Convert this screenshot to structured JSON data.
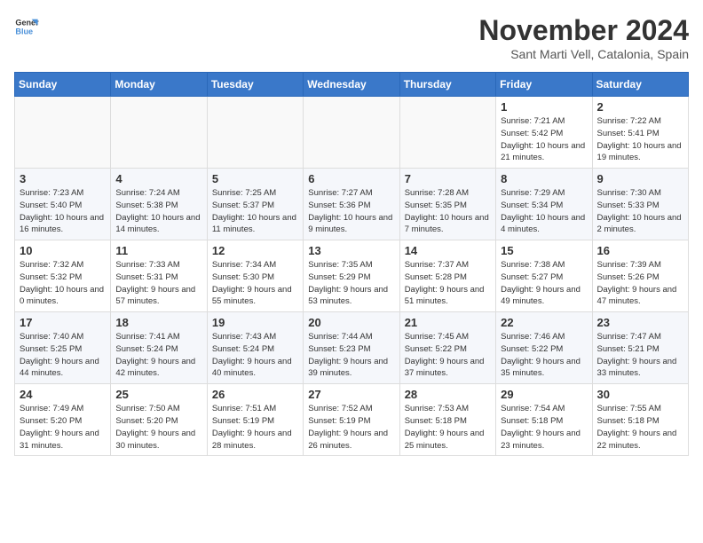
{
  "logo": {
    "line1": "General",
    "line2": "Blue"
  },
  "title": "November 2024",
  "location": "Sant Marti Vell, Catalonia, Spain",
  "headers": [
    "Sunday",
    "Monday",
    "Tuesday",
    "Wednesday",
    "Thursday",
    "Friday",
    "Saturday"
  ],
  "weeks": [
    [
      {
        "day": "",
        "info": ""
      },
      {
        "day": "",
        "info": ""
      },
      {
        "day": "",
        "info": ""
      },
      {
        "day": "",
        "info": ""
      },
      {
        "day": "",
        "info": ""
      },
      {
        "day": "1",
        "info": "Sunrise: 7:21 AM\nSunset: 5:42 PM\nDaylight: 10 hours and 21 minutes."
      },
      {
        "day": "2",
        "info": "Sunrise: 7:22 AM\nSunset: 5:41 PM\nDaylight: 10 hours and 19 minutes."
      }
    ],
    [
      {
        "day": "3",
        "info": "Sunrise: 7:23 AM\nSunset: 5:40 PM\nDaylight: 10 hours and 16 minutes."
      },
      {
        "day": "4",
        "info": "Sunrise: 7:24 AM\nSunset: 5:38 PM\nDaylight: 10 hours and 14 minutes."
      },
      {
        "day": "5",
        "info": "Sunrise: 7:25 AM\nSunset: 5:37 PM\nDaylight: 10 hours and 11 minutes."
      },
      {
        "day": "6",
        "info": "Sunrise: 7:27 AM\nSunset: 5:36 PM\nDaylight: 10 hours and 9 minutes."
      },
      {
        "day": "7",
        "info": "Sunrise: 7:28 AM\nSunset: 5:35 PM\nDaylight: 10 hours and 7 minutes."
      },
      {
        "day": "8",
        "info": "Sunrise: 7:29 AM\nSunset: 5:34 PM\nDaylight: 10 hours and 4 minutes."
      },
      {
        "day": "9",
        "info": "Sunrise: 7:30 AM\nSunset: 5:33 PM\nDaylight: 10 hours and 2 minutes."
      }
    ],
    [
      {
        "day": "10",
        "info": "Sunrise: 7:32 AM\nSunset: 5:32 PM\nDaylight: 10 hours and 0 minutes."
      },
      {
        "day": "11",
        "info": "Sunrise: 7:33 AM\nSunset: 5:31 PM\nDaylight: 9 hours and 57 minutes."
      },
      {
        "day": "12",
        "info": "Sunrise: 7:34 AM\nSunset: 5:30 PM\nDaylight: 9 hours and 55 minutes."
      },
      {
        "day": "13",
        "info": "Sunrise: 7:35 AM\nSunset: 5:29 PM\nDaylight: 9 hours and 53 minutes."
      },
      {
        "day": "14",
        "info": "Sunrise: 7:37 AM\nSunset: 5:28 PM\nDaylight: 9 hours and 51 minutes."
      },
      {
        "day": "15",
        "info": "Sunrise: 7:38 AM\nSunset: 5:27 PM\nDaylight: 9 hours and 49 minutes."
      },
      {
        "day": "16",
        "info": "Sunrise: 7:39 AM\nSunset: 5:26 PM\nDaylight: 9 hours and 47 minutes."
      }
    ],
    [
      {
        "day": "17",
        "info": "Sunrise: 7:40 AM\nSunset: 5:25 PM\nDaylight: 9 hours and 44 minutes."
      },
      {
        "day": "18",
        "info": "Sunrise: 7:41 AM\nSunset: 5:24 PM\nDaylight: 9 hours and 42 minutes."
      },
      {
        "day": "19",
        "info": "Sunrise: 7:43 AM\nSunset: 5:24 PM\nDaylight: 9 hours and 40 minutes."
      },
      {
        "day": "20",
        "info": "Sunrise: 7:44 AM\nSunset: 5:23 PM\nDaylight: 9 hours and 39 minutes."
      },
      {
        "day": "21",
        "info": "Sunrise: 7:45 AM\nSunset: 5:22 PM\nDaylight: 9 hours and 37 minutes."
      },
      {
        "day": "22",
        "info": "Sunrise: 7:46 AM\nSunset: 5:22 PM\nDaylight: 9 hours and 35 minutes."
      },
      {
        "day": "23",
        "info": "Sunrise: 7:47 AM\nSunset: 5:21 PM\nDaylight: 9 hours and 33 minutes."
      }
    ],
    [
      {
        "day": "24",
        "info": "Sunrise: 7:49 AM\nSunset: 5:20 PM\nDaylight: 9 hours and 31 minutes."
      },
      {
        "day": "25",
        "info": "Sunrise: 7:50 AM\nSunset: 5:20 PM\nDaylight: 9 hours and 30 minutes."
      },
      {
        "day": "26",
        "info": "Sunrise: 7:51 AM\nSunset: 5:19 PM\nDaylight: 9 hours and 28 minutes."
      },
      {
        "day": "27",
        "info": "Sunrise: 7:52 AM\nSunset: 5:19 PM\nDaylight: 9 hours and 26 minutes."
      },
      {
        "day": "28",
        "info": "Sunrise: 7:53 AM\nSunset: 5:18 PM\nDaylight: 9 hours and 25 minutes."
      },
      {
        "day": "29",
        "info": "Sunrise: 7:54 AM\nSunset: 5:18 PM\nDaylight: 9 hours and 23 minutes."
      },
      {
        "day": "30",
        "info": "Sunrise: 7:55 AM\nSunset: 5:18 PM\nDaylight: 9 hours and 22 minutes."
      }
    ]
  ]
}
